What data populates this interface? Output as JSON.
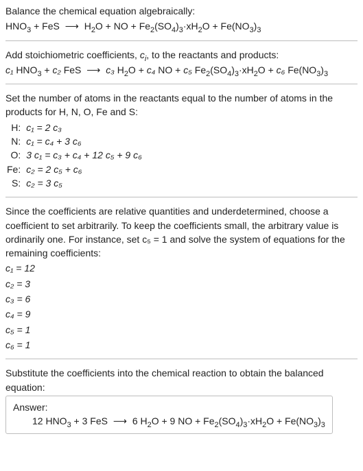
{
  "intro": {
    "line1": "Balance the chemical equation algebraically:",
    "reaction_lhs": "HNO₃ + FeS",
    "arrow": "⟶",
    "reaction_rhs": "H₂O + NO + Fe₂(SO₄)₃·xH₂O + Fe(NO₃)₃"
  },
  "step_coeffs": {
    "line1a": "Add stoichiometric coefficients, ",
    "ci": "c",
    "ci_sub": "i",
    "line1b": ", to the reactants and products:",
    "terms": {
      "c1": "c₁",
      "r1": "HNO₃",
      "c2": "c₂",
      "r2": "FeS",
      "arrow": "⟶",
      "c3": "c₃",
      "p1": "H₂O",
      "c4": "c₄",
      "p2": "NO",
      "c5": "c₅",
      "p3": "Fe₂(SO₄)₃·xH₂O",
      "c6": "c₆",
      "p4": "Fe(NO₃)₃"
    }
  },
  "step_sys": {
    "intro": "Set the number of atoms in the reactants equal to the number of atoms in the products for H, N, O, Fe and S:",
    "rows": [
      {
        "el": "H:",
        "eq": "c₁ = 2 c₃"
      },
      {
        "el": "N:",
        "eq": "c₁ = c₄ + 3 c₆"
      },
      {
        "el": "O:",
        "eq": "3 c₁ = c₃ + c₄ + 12 c₅ + 9 c₆"
      },
      {
        "el": "Fe:",
        "eq": "c₂ = 2 c₅ + c₆"
      },
      {
        "el": "S:",
        "eq": "c₂ = 3 c₅"
      }
    ]
  },
  "step_solve": {
    "intro": "Since the coefficients are relative quantities and underdetermined, choose a coefficient to set arbitrarily. To keep the coefficients small, the arbitrary value is ordinarily one. For instance, set c₅ = 1 and solve the system of equations for the remaining coefficients:",
    "solutions": [
      "c₁ = 12",
      "c₂ = 3",
      "c₃ = 6",
      "c₄ = 9",
      "c₅ = 1",
      "c₆ = 1"
    ]
  },
  "step_final": {
    "intro": "Substitute the coefficients into the chemical reaction to obtain the balanced equation:",
    "answer_label": "Answer:",
    "balanced_lhs": "12 HNO₃ + 3 FeS",
    "arrow": "⟶",
    "balanced_rhs": "6 H₂O + 9 NO + Fe₂(SO₄)₃·xH₂O + Fe(NO₃)₃"
  }
}
